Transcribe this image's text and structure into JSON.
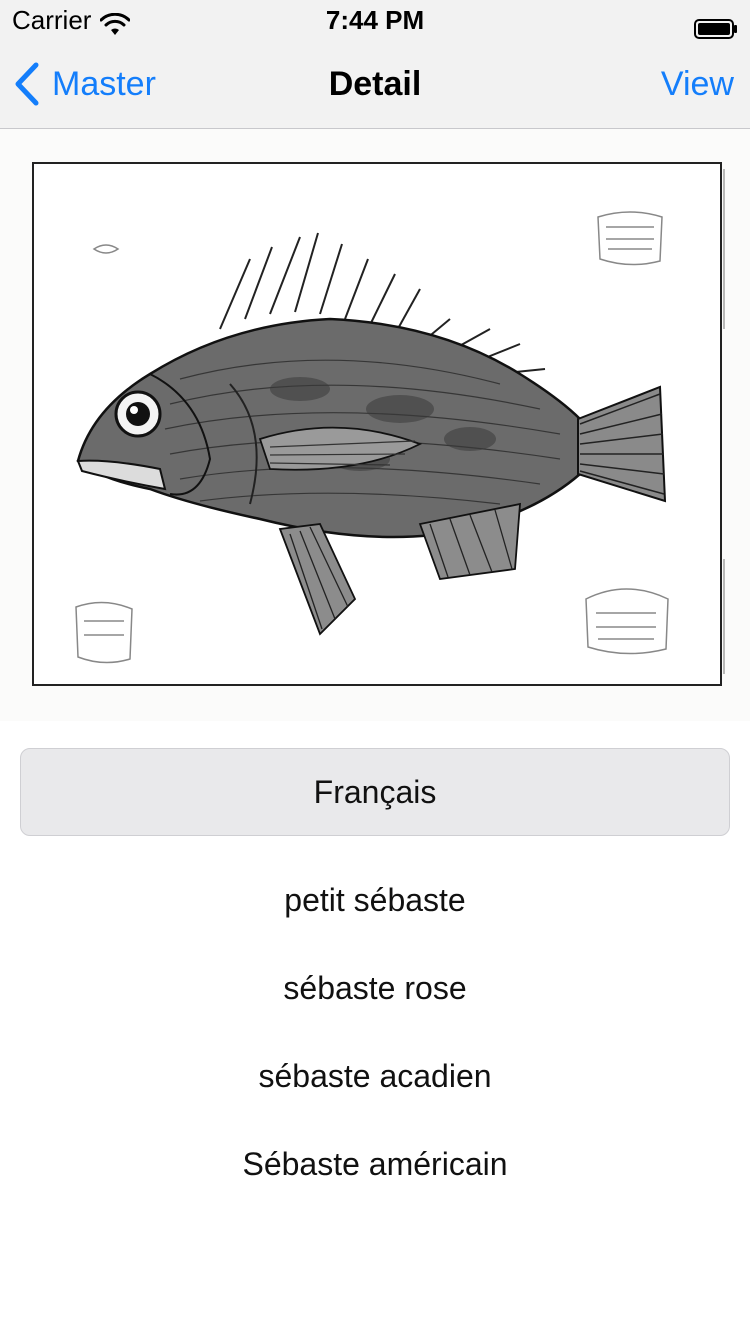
{
  "status_bar": {
    "carrier": "Carrier",
    "time": "7:44 PM",
    "icons": [
      "wifi-icon",
      "battery-icon"
    ]
  },
  "nav": {
    "back_label": "Master",
    "title": "Detail",
    "right_label": "View",
    "accent_color": "#147efb",
    "back_icon": "chevron-left-icon"
  },
  "illustration": {
    "subject": "fish-plate-engraving"
  },
  "language_button": {
    "label": "Français"
  },
  "names": [
    "petit sébaste",
    "sébaste rose",
    "sébaste acadien",
    "Sébaste américain"
  ]
}
